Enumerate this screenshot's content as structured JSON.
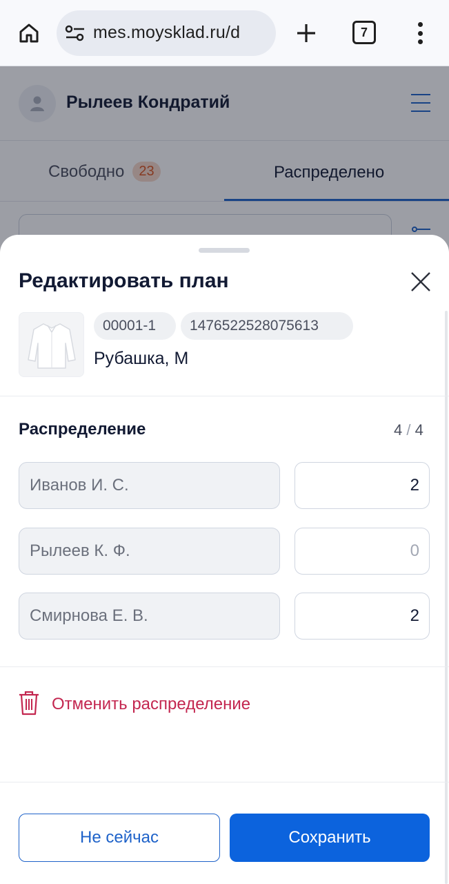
{
  "browser": {
    "url": "mes.moysklad.ru/d",
    "tab_count": "7"
  },
  "header": {
    "user_name": "Рылеев Кондратий"
  },
  "tabs": {
    "free_label": "Свободно",
    "free_count": "23",
    "distributed_label": "Распределено"
  },
  "sheet": {
    "title": "Редактировать план",
    "product": {
      "code": "00001-1",
      "barcode": "1476522528075613",
      "name": "Рубашка, М"
    },
    "distribution": {
      "title": "Распределение",
      "counter_current": "4",
      "counter_separator": "/",
      "counter_total": "4",
      "rows": [
        {
          "person": "Иванов И. С.",
          "quantity": "2"
        },
        {
          "person": "Рылеев К. Ф.",
          "quantity": "0"
        },
        {
          "person": "Смирнова Е. В.",
          "quantity": "2"
        }
      ]
    },
    "cancel_label": "Отменить распределение",
    "secondary_button": "Не сейчас",
    "primary_button": "Сохранить"
  },
  "colors": {
    "accent": "#0c63dd",
    "danger": "#c3264f",
    "badge_bg": "#f6d7c8",
    "badge_text": "#d9531e"
  }
}
